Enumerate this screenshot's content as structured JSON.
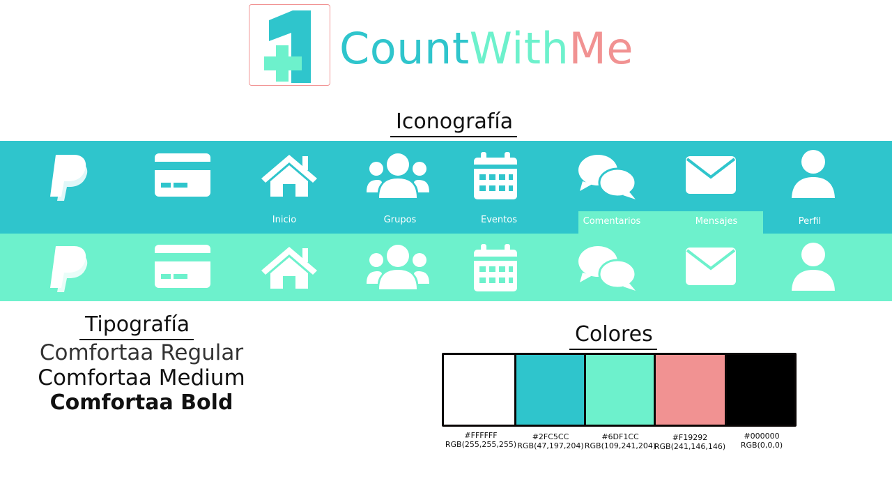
{
  "brand": {
    "part1": "Count",
    "part2": "With",
    "part3": "Me",
    "colors": {
      "count": "#2FC5CC",
      "with": "#6DF1CC",
      "me": "#F19292"
    },
    "logo_icon": "number-one-plus-icon"
  },
  "sections": {
    "iconography": "Iconografía",
    "typography": "Tipografía",
    "colors": "Colores"
  },
  "nav": {
    "icons": [
      "paypal-icon",
      "credit-card-icon",
      "home-icon",
      "users-icon",
      "calendar-icon",
      "comments-icon",
      "envelope-icon",
      "user-icon"
    ],
    "labels": {
      "inicio": "Inicio",
      "grupos": "Grupos",
      "eventos": "Eventos",
      "comentarios": "Comentarios",
      "mensajes": "Mensajes",
      "perfil": "Perfil"
    }
  },
  "typography": {
    "regular": "Comfortaa Regular",
    "medium": "Comfortaa Medium",
    "bold": "Comfortaa Bold"
  },
  "palette": [
    {
      "hex": "#FFFFFF",
      "rgb": "RGB(255,255,255)"
    },
    {
      "hex": "#2FC5CC",
      "rgb": "RGB(47,197,204)"
    },
    {
      "hex": "#6DF1CC",
      "rgb": "RGB(109,241,204)"
    },
    {
      "hex": "#F19292",
      "rgb": "RGB(241,146,146)"
    },
    {
      "hex": "#000000",
      "rgb": "RGB(0,0,0)"
    }
  ]
}
